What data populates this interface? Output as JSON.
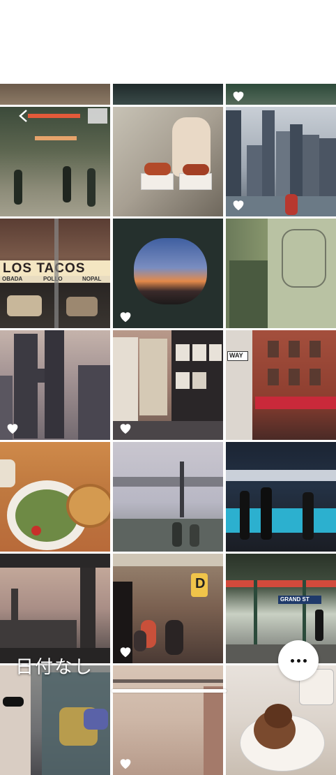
{
  "album": {
    "label": "日付なし"
  },
  "controls": {
    "more_icon": "ellipsis-icon",
    "back_icon": "chevron-left-icon",
    "heart_icon": "heart-icon"
  },
  "signage": {
    "tacos": "LOS TACOS",
    "tacos_sub_left": "OBADA",
    "tacos_sub_mid": "POLLO",
    "tacos_sub_right": "NOPAL",
    "way": "WAY",
    "station": "GRAND ST",
    "train": "D"
  },
  "photos": [
    {
      "subject": "top-partial-left",
      "favorite": false
    },
    {
      "subject": "top-partial-middle",
      "favorite": false
    },
    {
      "subject": "top-partial-right",
      "favorite": true
    },
    {
      "subject": "subway-platform",
      "favorite": false
    },
    {
      "subject": "food-trays",
      "favorite": false
    },
    {
      "subject": "city-skyline-waterfront",
      "favorite": true
    },
    {
      "subject": "taco-shop",
      "favorite": false
    },
    {
      "subject": "airplane-window-sunset",
      "favorite": true
    },
    {
      "subject": "graffiti-stairwell",
      "favorite": false
    },
    {
      "subject": "twin-towers-building",
      "favorite": true
    },
    {
      "subject": "poster-wall-street",
      "favorite": true
    },
    {
      "subject": "brick-storefront",
      "favorite": false
    },
    {
      "subject": "salad-and-quiche",
      "favorite": false
    },
    {
      "subject": "bridge-from-ferry",
      "favorite": false
    },
    {
      "subject": "food-counter-night",
      "favorite": false
    },
    {
      "subject": "skyline-dusk-train",
      "favorite": false
    },
    {
      "subject": "subway-car-riders",
      "favorite": true
    },
    {
      "subject": "grand-st-station",
      "favorite": false
    },
    {
      "subject": "graffiti-fence",
      "favorite": false
    },
    {
      "subject": "tiled-wall",
      "favorite": true
    },
    {
      "subject": "pastry-and-coffee",
      "favorite": false
    }
  ]
}
